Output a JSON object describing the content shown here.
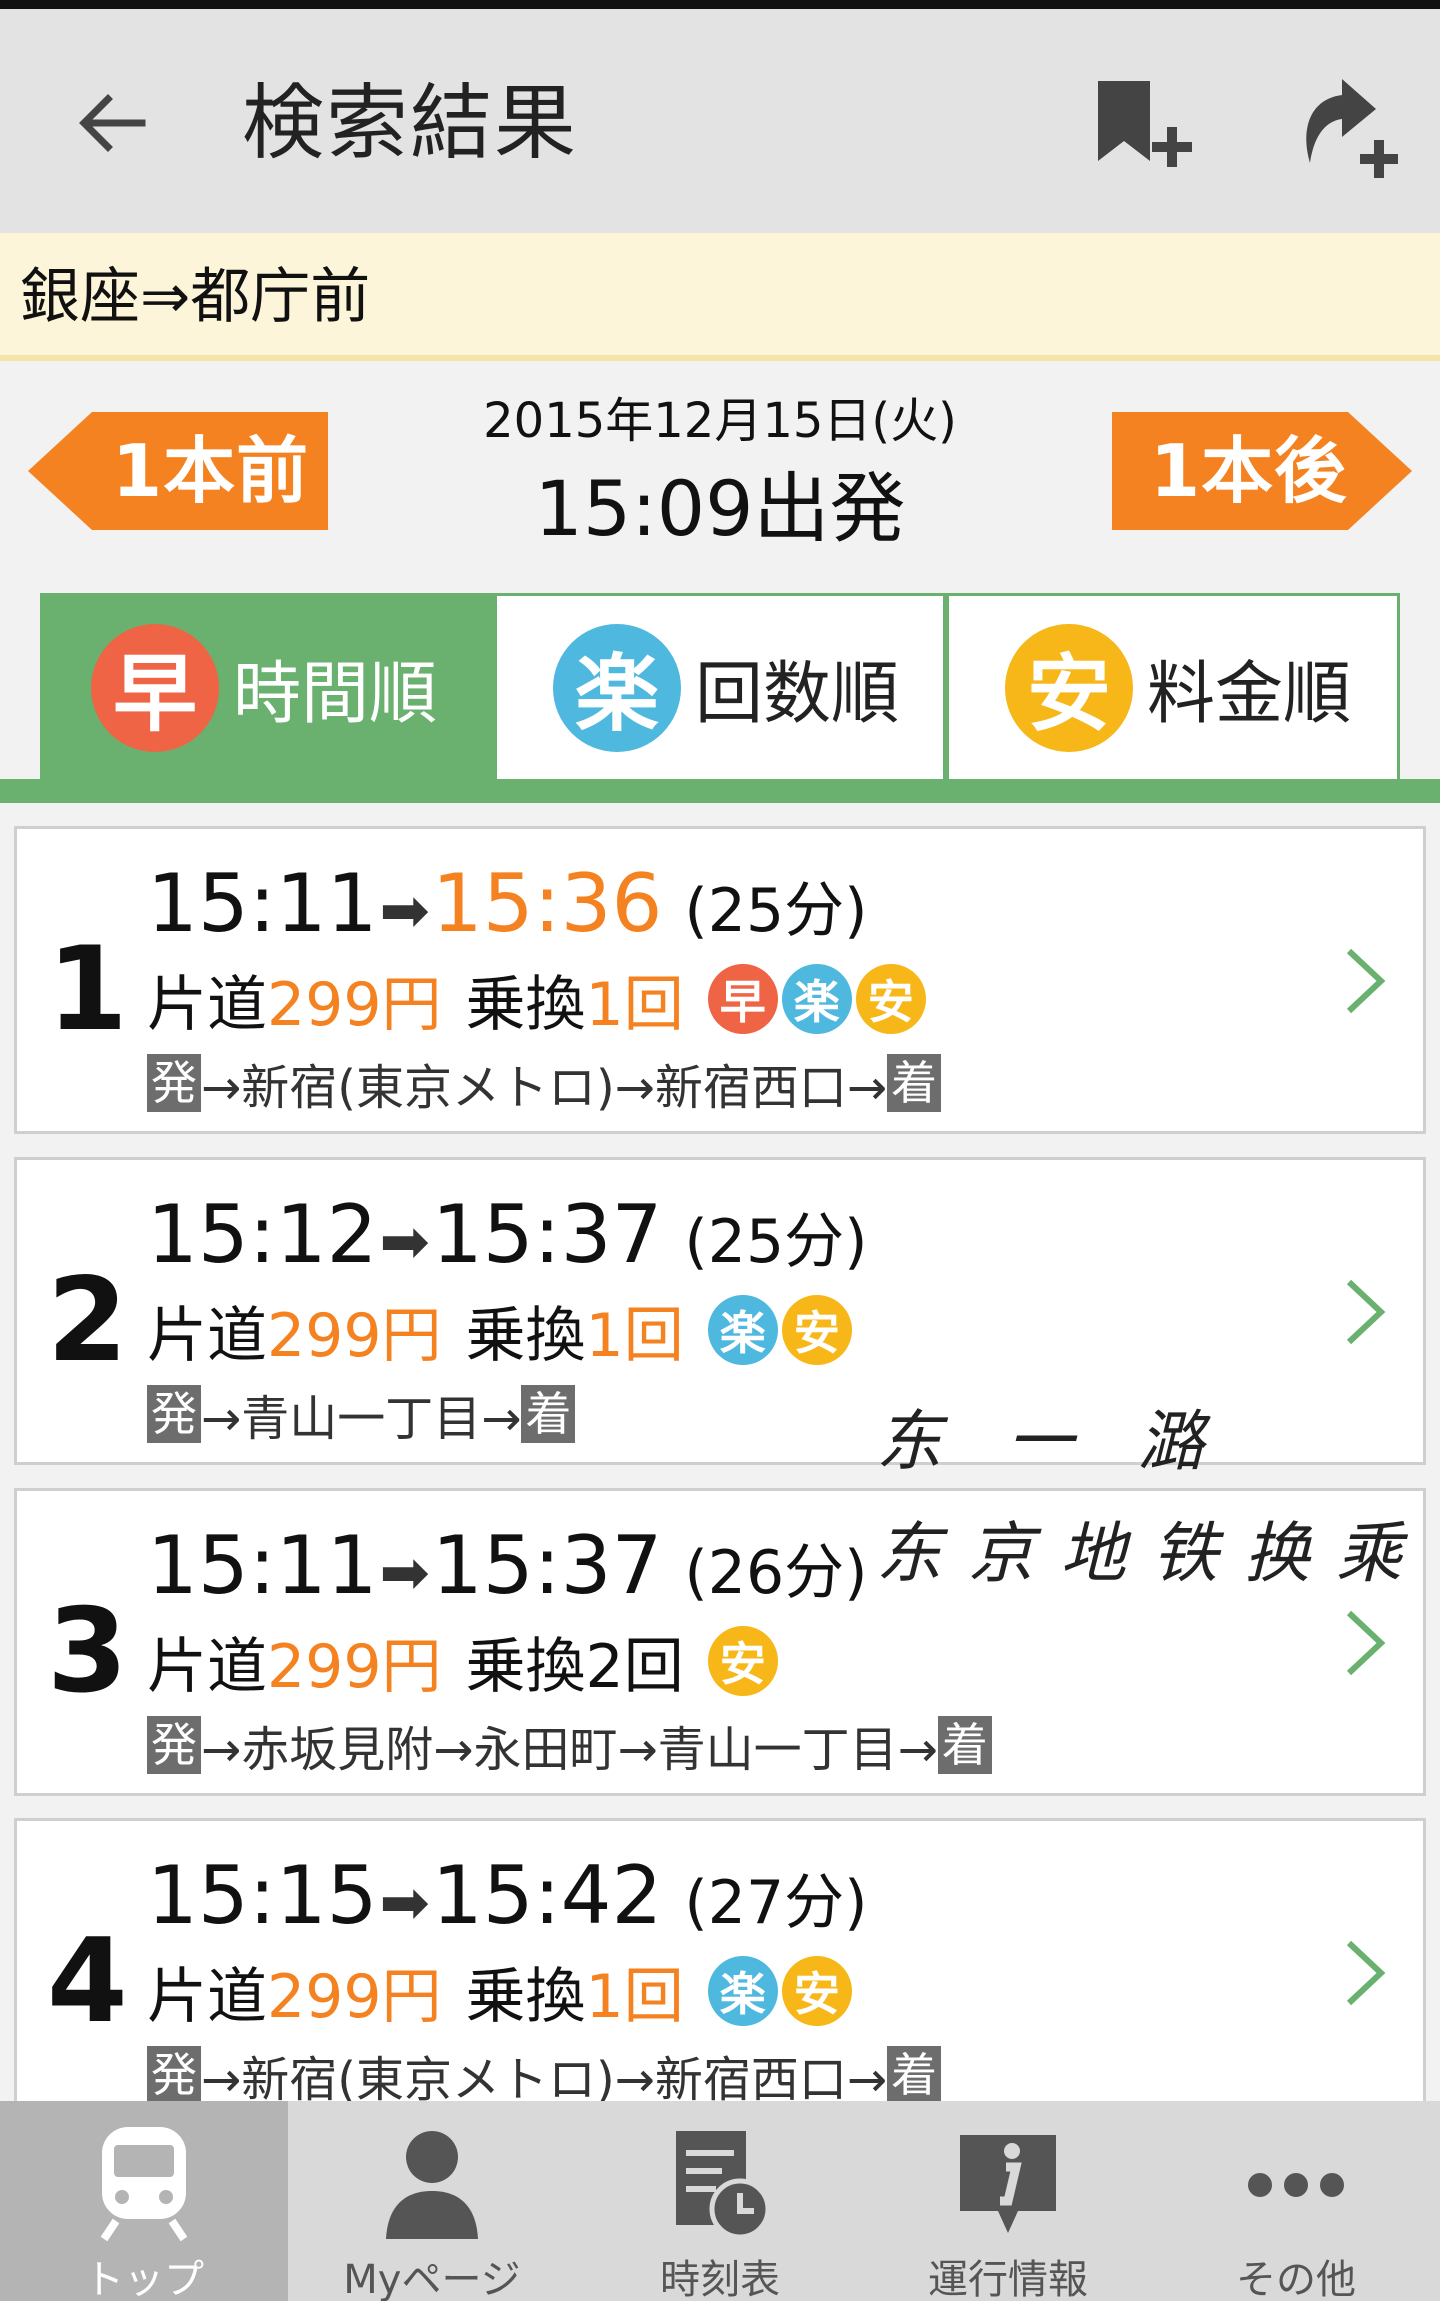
{
  "header": {
    "title": "検索結果",
    "back_icon": "arrow-left-icon",
    "bookmark_icon": "bookmark-add-icon",
    "share_icon": "share-add-icon"
  },
  "route": {
    "text": "銀座⇒都庁前"
  },
  "datebar": {
    "prev_label": "1本前",
    "date": "2015年12月15日(火)",
    "depart": "15:09出発",
    "next_label": "1本後"
  },
  "sort_tabs": [
    {
      "badge": "早",
      "label": "時間順",
      "color": "#ef6445",
      "active": true
    },
    {
      "badge": "楽",
      "label": "回数順",
      "color": "#4fb8df",
      "active": false
    },
    {
      "badge": "安",
      "label": "料金順",
      "color": "#f7b718",
      "active": false
    }
  ],
  "results": [
    {
      "index": "1",
      "dep": "15:11",
      "arr": "15:36",
      "arr_highlight": true,
      "duration": "(25分)",
      "fare_label": "片道",
      "fare": "299円",
      "transfer_label": "乗換",
      "transfers": "1回",
      "transfers_highlight": true,
      "badges": [
        "早",
        "楽",
        "安"
      ],
      "start_tag": "発",
      "path": "→新宿(東京メトロ)→新宿西口→",
      "end_tag": "着"
    },
    {
      "index": "2",
      "dep": "15:12",
      "arr": "15:37",
      "arr_highlight": false,
      "duration": "(25分)",
      "fare_label": "片道",
      "fare": "299円",
      "transfer_label": "乗換",
      "transfers": "1回",
      "transfers_highlight": true,
      "badges": [
        "楽",
        "安"
      ],
      "start_tag": "発",
      "path": "→青山一丁目→",
      "end_tag": "着"
    },
    {
      "index": "3",
      "dep": "15:11",
      "arr": "15:37",
      "arr_highlight": false,
      "duration": "(26分)",
      "fare_label": "片道",
      "fare": "299円",
      "transfer_label": "乗換",
      "transfers": "2回",
      "transfers_highlight": false,
      "badges": [
        "安"
      ],
      "start_tag": "発",
      "path": "→赤坂見附→永田町→青山一丁目→",
      "end_tag": "着"
    },
    {
      "index": "4",
      "dep": "15:15",
      "arr": "15:42",
      "arr_highlight": false,
      "duration": "(27分)",
      "fare_label": "片道",
      "fare": "299円",
      "transfer_label": "乗換",
      "transfers": "1回",
      "transfers_highlight": true,
      "badges": [
        "楽",
        "安"
      ],
      "start_tag": "発",
      "path": "→新宿(東京メトロ)→新宿西口→",
      "end_tag": "着"
    }
  ],
  "annotations": {
    "line1": "东 一 潞",
    "line2": "东京地铁换乘"
  },
  "nav": [
    {
      "label": "トップ",
      "icon": "train-icon",
      "active": true
    },
    {
      "label": "Myページ",
      "icon": "person-icon",
      "active": false
    },
    {
      "label": "時刻表",
      "icon": "timetable-icon",
      "active": false
    },
    {
      "label": "運行情報",
      "icon": "info-icon",
      "active": false
    },
    {
      "label": "その他",
      "icon": "more-icon",
      "active": false
    }
  ],
  "colors": {
    "accent_orange": "#f58220",
    "green": "#6ab06f",
    "haya_red": "#ef6445",
    "raku_blue": "#4fb8df",
    "yasu_yellow": "#f7b718"
  }
}
